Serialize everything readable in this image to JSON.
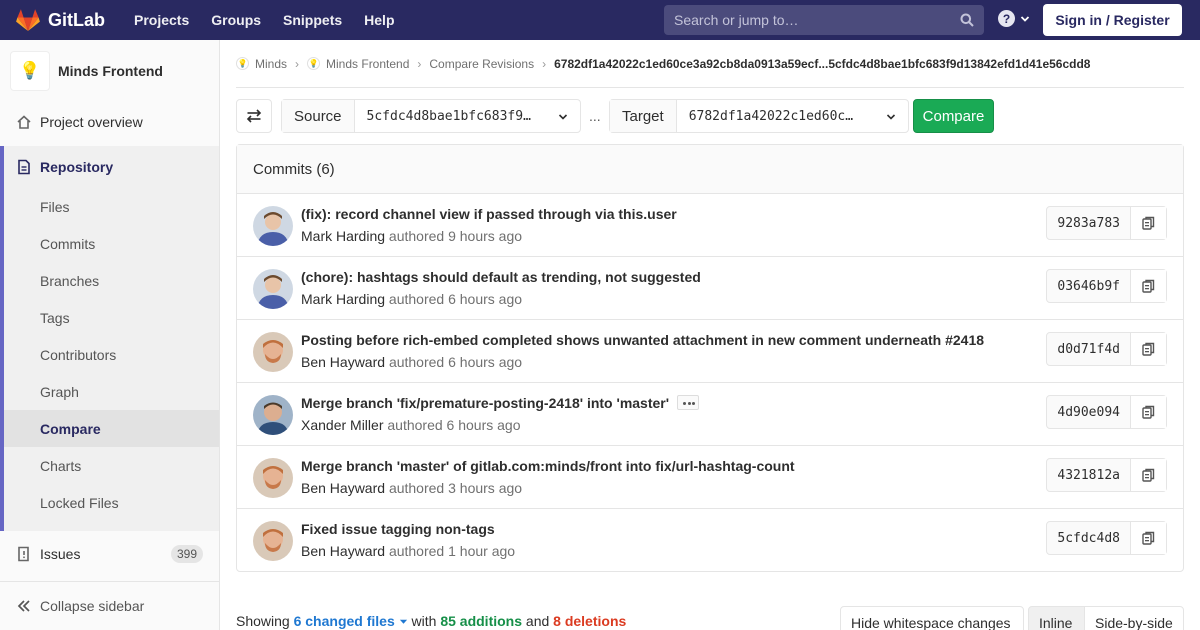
{
  "navbar": {
    "brand": "GitLab",
    "links": [
      "Projects",
      "Groups",
      "Snippets",
      "Help"
    ],
    "search_placeholder": "Search or jump to…",
    "help_glyph": "?",
    "signin_label": "Sign in / Register",
    "bg_color": "#292961"
  },
  "sidebar": {
    "project_name": "Minds Frontend",
    "project_avatar": "💡",
    "overview_label": "Project overview",
    "repository_label": "Repository",
    "repo_items": [
      "Files",
      "Commits",
      "Branches",
      "Tags",
      "Contributors",
      "Graph",
      "Compare",
      "Charts",
      "Locked Files"
    ],
    "active_item": "Compare",
    "issues_label": "Issues",
    "issues_count": "399",
    "collapse_label": "Collapse sidebar"
  },
  "breadcrumb": {
    "items": [
      "Minds",
      "Minds Frontend",
      "Compare Revisions"
    ],
    "current": "6782df1a42022c1ed60ce3a92cb8da0913a59ecf...5cfdc4d8bae1bfc683f9d13842efd1d41e56cdd8"
  },
  "compare_form": {
    "source_label": "Source",
    "source_value": "5cfdc4d8bae1bfc683f9…",
    "separator": "...",
    "target_label": "Target",
    "target_value": "6782df1a42022c1ed60c…",
    "compare_label": "Compare",
    "compare_color": "#1aaa55"
  },
  "commits": {
    "header": "Commits (6)",
    "authored_word": "authored",
    "items": [
      {
        "title": "(fix): record channel view if passed through via this.user",
        "author": "Mark Harding",
        "when": "9 hours ago",
        "sha": "9283a783",
        "avatar": "mark"
      },
      {
        "title": "(chore): hashtags should default as trending, not suggested",
        "author": "Mark Harding",
        "when": "6 hours ago",
        "sha": "03646b9f",
        "avatar": "mark"
      },
      {
        "title": "Posting before rich-embed completed shows unwanted attachment in new comment underneath #2418",
        "author": "Ben Hayward",
        "when": "6 hours ago",
        "sha": "d0d71f4d",
        "avatar": "ben"
      },
      {
        "title": "Merge branch 'fix/premature-posting-2418' into 'master'",
        "author": "Xander Miller",
        "when": "6 hours ago",
        "sha": "4d90e094",
        "avatar": "xander",
        "has_more": true
      },
      {
        "title": "Merge branch 'master' of gitlab.com:minds/front into fix/url-hashtag-count",
        "author": "Ben Hayward",
        "when": "3 hours ago",
        "sha": "4321812a",
        "avatar": "ben"
      },
      {
        "title": "Fixed issue tagging non-tags",
        "author": "Ben Hayward",
        "when": "1 hour ago",
        "sha": "5cfdc4d8",
        "avatar": "ben"
      }
    ]
  },
  "diff_stats": {
    "showing": "Showing",
    "changed_files": "6 changed files",
    "with": "with",
    "additions": "85 additions",
    "and": "and",
    "deletions": "8 deletions",
    "hide_whitespace": "Hide whitespace changes",
    "inline": "Inline",
    "side_by_side": "Side-by-side",
    "addition_color": "#168f48",
    "deletion_color": "#db3b21"
  }
}
